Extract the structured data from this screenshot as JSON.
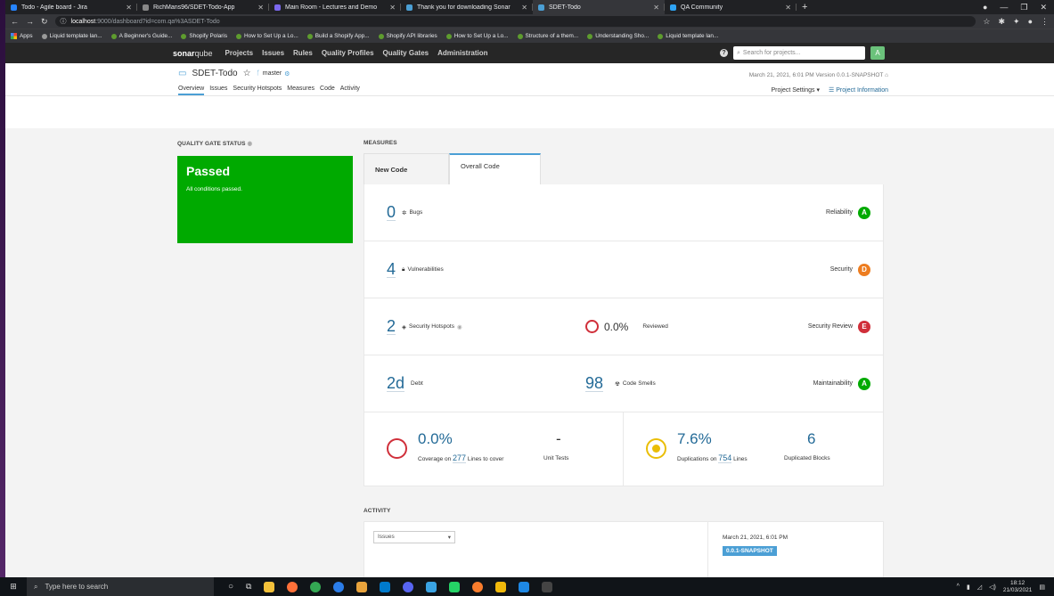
{
  "browser": {
    "tabs": [
      {
        "title": "Todo - Agile board - Jira",
        "color": "#2684ff"
      },
      {
        "title": "RichMans96/SDET-Todo-App",
        "color": "#888888"
      },
      {
        "title": "Main Room - Lectures and Demo",
        "color": "#7b68ee"
      },
      {
        "title": "Thank you for downloading Sonar",
        "color": "#4b9fd5"
      },
      {
        "title": "SDET-Todo",
        "color": "#4b9fd5"
      },
      {
        "title": "QA Community",
        "color": "#2ea3f2"
      }
    ],
    "active_tab": 4,
    "url_host": "localhost",
    "url_path": ":9000/dashboard?id=com.qa%3ASDET-Todo",
    "bookmarks": [
      "Apps",
      "Liquid template lan...",
      "A Beginner's Guide...",
      "Shopify Polaris",
      "How to Set Up a Lo...",
      "Build a Shopify App...",
      "Shopify API libraries",
      "How to Set Up a Lo...",
      "Structure of a them...",
      "Understanding Sho...",
      "Liquid template lan..."
    ]
  },
  "sonar": {
    "logo_a": "sonar",
    "logo_b": "qube",
    "nav": [
      "Projects",
      "Issues",
      "Rules",
      "Quality Profiles",
      "Quality Gates",
      "Administration"
    ],
    "search_placeholder": "Search for projects...",
    "avatar": "A"
  },
  "project": {
    "name": "SDET-Todo",
    "branch": "master",
    "meta": "March 21, 2021, 6:01 PM  Version 0.0.1-SNAPSHOT",
    "tabs": [
      "Overview",
      "Issues",
      "Security Hotspots",
      "Measures",
      "Code",
      "Activity"
    ],
    "settings": "Project Settings",
    "info": "Project Information"
  },
  "quality_gate": {
    "title": "QUALITY GATE STATUS",
    "status": "Passed",
    "detail": "All conditions passed.",
    "color": "#00aa00"
  },
  "measures": {
    "title": "MEASURES",
    "tabs": [
      "New Code",
      "Overall Code"
    ],
    "bugs": {
      "value": "0",
      "label": "Bugs",
      "category": "Reliability",
      "rating": "A",
      "color": "#00aa00"
    },
    "vulnerabilities": {
      "value": "4",
      "label": "Vulnerabilities",
      "category": "Security",
      "rating": "D",
      "color": "#ed7d20"
    },
    "hotspots": {
      "value": "2",
      "label": "Security Hotspots",
      "reviewed_pct": "0.0%",
      "reviewed_label": "Reviewed",
      "category": "Security Review",
      "rating": "E",
      "color": "#d02f3a"
    },
    "debt": {
      "value": "2d",
      "label": "Debt",
      "smells": "98",
      "smells_label": "Code Smells",
      "category": "Maintainability",
      "rating": "A",
      "color": "#00aa00"
    },
    "coverage": {
      "value": "0.0%",
      "prefix": "Coverage on",
      "lines": "277",
      "suffix": "Lines to cover",
      "unit_tests": "-",
      "unit_tests_label": "Unit Tests"
    },
    "duplications": {
      "value": "7.6%",
      "prefix": "Duplications on",
      "lines": "754",
      "suffix": "Lines",
      "blocks": "6",
      "blocks_label": "Duplicated Blocks"
    }
  },
  "activity": {
    "title": "ACTIVITY",
    "select": "Issues",
    "date": "March 21, 2021, 6:01 PM",
    "version": "0.0.1-SNAPSHOT"
  },
  "taskbar": {
    "search": "Type here to search",
    "time": "18:12",
    "date": "21/03/2021"
  }
}
